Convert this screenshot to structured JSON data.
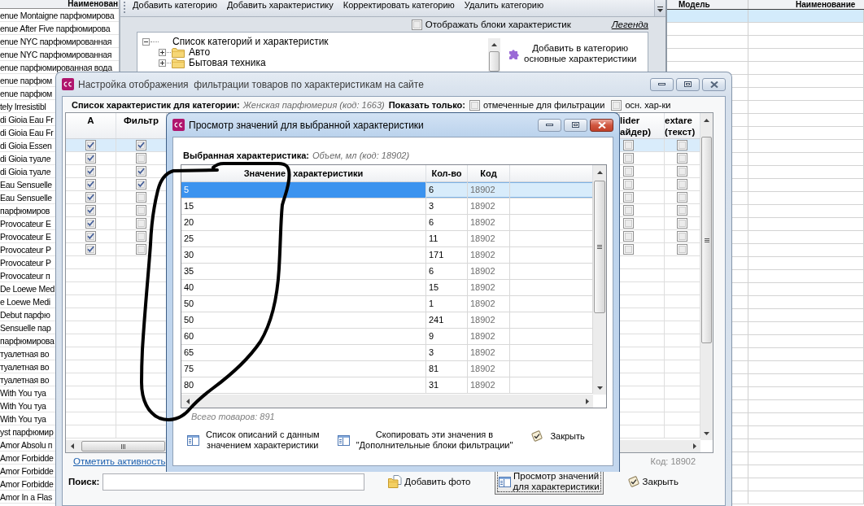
{
  "background_app": {
    "product_list": {
      "column": "Наименован",
      "rows": [
        "enue Montaigne парфюмирова",
        "enue After Five парфюмирова",
        "enue NYC парфюмированная",
        "enue NYC парфюмированная",
        "enue парфюмированная вода",
        "enue парфюм",
        "enue парфюм",
        "tely Irresistibl",
        "di Gioia Eau Fr",
        "di Gioia Eau Fr",
        "di Gioia Essen",
        "di Gioia туале",
        "di Gioia туале",
        "Eau Sensuelle",
        "Eau Sensuelle",
        "парфюмиров",
        "Provocateur E",
        "Provocateur E",
        "Provocateur P",
        "Provocateur P",
        "Provocateur п",
        "De Loewe Med",
        "e Loewe Medi",
        "Debut парфю",
        "Sensuelle пар",
        "парфюмирова",
        "туалетная во",
        "туалетная во",
        "туалетная во",
        "With You туа",
        "With You туа",
        "With You туа",
        "yst парфюмир",
        "Amor Absolu п",
        "Amor Forbidde",
        "Amor Forbidde",
        "Amor Forbidde",
        "Amor In a Flas"
      ]
    },
    "toolbar": [
      "Добавить категорию",
      "Добавить характеристику",
      "Корректировать категорию",
      "Удалить категорию"
    ],
    "show_blocks": {
      "label": "Отображать блоки характеристик",
      "checked": false
    },
    "legend_link": "Легенда",
    "category_tree": {
      "label": "Список категорий и характеристик",
      "expanded": true,
      "children": [
        {
          "label": "Авто",
          "expanded": false
        },
        {
          "label": "Бытовая техника",
          "expanded": false
        }
      ]
    },
    "add_basic_button": "Добавить в категорию\nосновные характеристики",
    "model_table": {
      "columns": [
        "Модель",
        "Наименование"
      ],
      "rows": [
        {
          "selected": true
        },
        {
          "selected": false
        },
        {
          "selected": false
        },
        {
          "selected": false
        },
        {
          "selected": false
        },
        {
          "selected": false
        },
        {
          "selected": false
        },
        {
          "selected": false
        },
        {
          "selected": false
        },
        {
          "selected": false
        },
        {
          "selected": false
        },
        {
          "selected": false
        },
        {
          "selected": false
        },
        {
          "selected": false
        },
        {
          "selected": false
        },
        {
          "selected": false
        },
        {
          "selected": false
        },
        {
          "selected": false
        },
        {
          "selected": false
        },
        {
          "selected": false
        },
        {
          "selected": false
        },
        {
          "selected": false
        },
        {
          "selected": false
        },
        {
          "selected": false
        },
        {
          "selected": false
        },
        {
          "selected": false
        },
        {
          "selected": false
        },
        {
          "selected": false
        },
        {
          "selected": false
        },
        {
          "selected": false
        },
        {
          "selected": false
        },
        {
          "selected": false
        },
        {
          "selected": false
        },
        {
          "selected": false
        },
        {
          "selected": false
        },
        {
          "selected": false
        },
        {
          "selected": false
        },
        {
          "selected": false
        }
      ]
    }
  },
  "settings_dialog": {
    "title": "Настройка отображения  фильтрации товаров по характеристикам на сайте",
    "active": false,
    "category_label": "Список характеристик для категории:",
    "category_value": "Женская парфюмерия (код: 1663)",
    "show_only_label": "Показать только:",
    "filters": [
      {
        "label": "отмеченные для фильтрации",
        "checked": false
      },
      {
        "label": "осн. хар-ки",
        "checked": false
      }
    ],
    "grid": {
      "columns": [
        "А",
        "Фильтр",
        "lider\nайдер)",
        "extare\n(текст)"
      ],
      "rows": [
        {
          "checks": [
            true,
            true,
            false,
            false
          ],
          "selected": true
        },
        {
          "checks": [
            true,
            false,
            false,
            false
          ],
          "selected": false
        },
        {
          "checks": [
            true,
            true,
            false,
            false
          ],
          "selected": false
        },
        {
          "checks": [
            true,
            true,
            false,
            false
          ],
          "selected": false
        },
        {
          "checks": [
            true,
            false,
            false,
            false
          ],
          "selected": false
        },
        {
          "checks": [
            true,
            false,
            false,
            false
          ],
          "selected": false
        },
        {
          "checks": [
            true,
            false,
            false,
            false
          ],
          "selected": false
        },
        {
          "checks": [
            true,
            false,
            false,
            false
          ],
          "selected": false
        },
        {
          "checks": [
            true,
            false,
            false,
            false
          ],
          "selected": false
        }
      ]
    },
    "mark_activity_link": "Отметить активность",
    "code_text": "Код: 18902",
    "search_label": "Поиск:",
    "buttons": [
      {
        "label": "Добавить фото",
        "kind": "photo",
        "focused": false
      },
      {
        "label": "Просмотр значений\nдля характеристики",
        "kind": "view",
        "focused": true
      },
      {
        "label": "Закрыть",
        "kind": "close",
        "focused": false
      }
    ]
  },
  "values_dialog": {
    "title": "Просмотр значений для выбранной характеристики",
    "active": true,
    "char_label": "Выбранная характеристика:",
    "char_value": "Объем, мл (код: 18902)",
    "grid": {
      "columns": [
        "Значение характеристики",
        "Кол-во",
        "Код"
      ],
      "rows": [
        {
          "value": "5",
          "count": "6",
          "code": "18902",
          "selected": true
        },
        {
          "value": "15",
          "count": "3",
          "code": "18902",
          "selected": false
        },
        {
          "value": "20",
          "count": "6",
          "code": "18902",
          "selected": false
        },
        {
          "value": "25",
          "count": "11",
          "code": "18902",
          "selected": false
        },
        {
          "value": "30",
          "count": "171",
          "code": "18902",
          "selected": false
        },
        {
          "value": "35",
          "count": "6",
          "code": "18902",
          "selected": false
        },
        {
          "value": "40",
          "count": "15",
          "code": "18902",
          "selected": false
        },
        {
          "value": "50",
          "count": "1",
          "code": "18902",
          "selected": false
        },
        {
          "value": "50",
          "count": "241",
          "code": "18902",
          "selected": false
        },
        {
          "value": "60",
          "count": "9",
          "code": "18902",
          "selected": false
        },
        {
          "value": "65",
          "count": "3",
          "code": "18902",
          "selected": false
        },
        {
          "value": "75",
          "count": "81",
          "code": "18902",
          "selected": false
        },
        {
          "value": "80",
          "count": "31",
          "code": "18902",
          "selected": false
        }
      ]
    },
    "total": "Всего товаров: 891",
    "buttons": [
      {
        "label": "Список описаний с данным\nзначением характеристики",
        "kind": "list"
      },
      {
        "label": "Скопировать эти значения в\n\"Дополнительные блоки фильтрации\"",
        "kind": "list"
      },
      {
        "label": "Закрыть",
        "kind": "close"
      }
    ]
  }
}
